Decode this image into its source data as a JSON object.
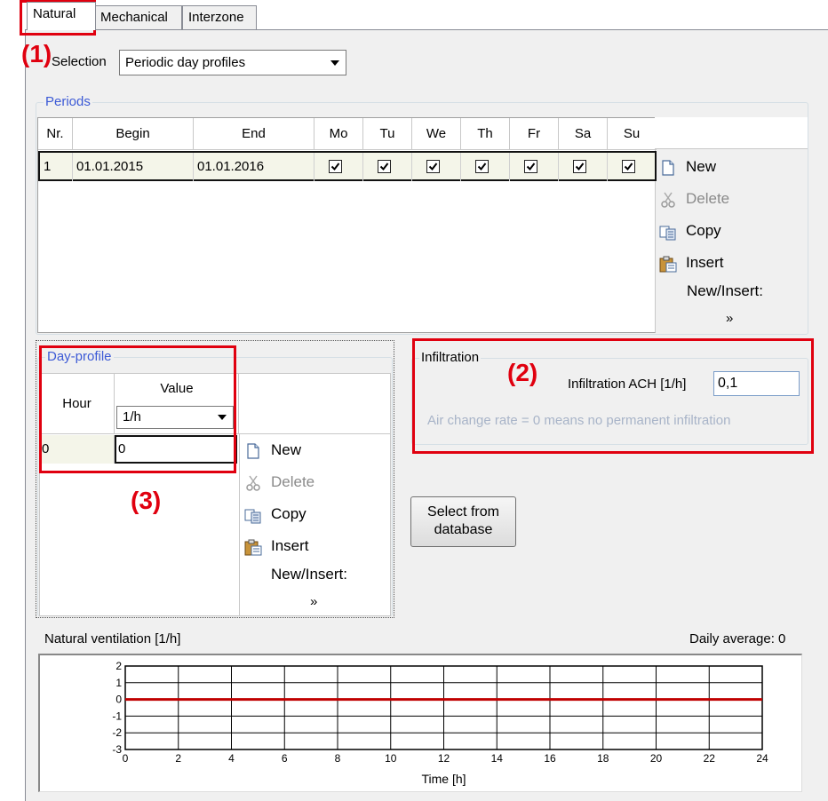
{
  "tabs": [
    {
      "label": "Natural",
      "active": true
    },
    {
      "label": "Mechanical",
      "active": false
    },
    {
      "label": "Interzone",
      "active": false
    }
  ],
  "annotations": {
    "a1": "(1)",
    "a2": "(2)",
    "a3": "(3)"
  },
  "selection": {
    "label": "Selection",
    "value": "Periodic day profiles"
  },
  "periods": {
    "legend": "Periods",
    "columns": [
      "Nr.",
      "Begin",
      "End",
      "Mo",
      "Tu",
      "We",
      "Th",
      "Fr",
      "Sa",
      "Su"
    ],
    "rows": [
      {
        "nr": "1",
        "begin": "01.01.2015",
        "end": "01.01.2016",
        "days": [
          true,
          true,
          true,
          true,
          true,
          true,
          true
        ]
      }
    ],
    "actions": {
      "new": "New",
      "delete": "Delete",
      "copy": "Copy",
      "insert": "Insert",
      "new_insert": "New/Insert:",
      "more": "»"
    }
  },
  "day_profile": {
    "legend": "Day-profile",
    "col_hour": "Hour",
    "col_value": "Value",
    "unit_value": "1/h",
    "rows": [
      {
        "hour": "0",
        "value": "0"
      }
    ],
    "actions": {
      "new": "New",
      "delete": "Delete",
      "copy": "Copy",
      "insert": "Insert",
      "new_insert": "New/Insert:",
      "more": "»"
    }
  },
  "infiltration": {
    "legend": "Infiltration",
    "label": "Infiltration ACH  [1/h]",
    "value": "0,1",
    "hint": "Air change rate = 0 means no permanent infiltration"
  },
  "select_button": {
    "line1": "Select from",
    "line2": "database"
  },
  "chart_header": {
    "title": "Natural ventilation [1/h]",
    "daily_average": "Daily average: 0"
  },
  "colors": {
    "accent_red": "#e0000f",
    "legend_blue": "#3c5ad6",
    "line_red": "#c00000"
  },
  "chart_data": {
    "type": "line",
    "title": "Natural ventilation [1/h]",
    "xlabel": "Time [h]",
    "ylabel": "",
    "xlim": [
      0,
      24
    ],
    "ylim": [
      -3,
      2
    ],
    "xticks": [
      0,
      2,
      4,
      6,
      8,
      10,
      12,
      14,
      16,
      18,
      20,
      22,
      24
    ],
    "yticks": [
      2,
      1,
      0,
      -1,
      -2,
      -3
    ],
    "grid": true,
    "series": [
      {
        "x": [
          0,
          24
        ],
        "y": [
          0,
          0
        ],
        "color": "#c00000"
      }
    ]
  }
}
